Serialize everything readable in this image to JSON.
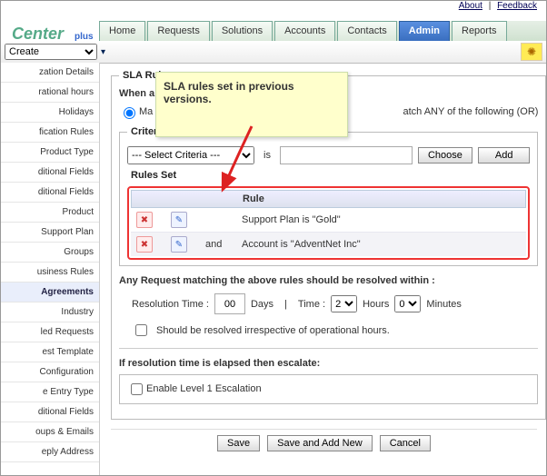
{
  "topbar": {
    "about": "About",
    "feedback": "Feedback"
  },
  "brand": {
    "main": "Center",
    "plus": "plus"
  },
  "tabs": [
    {
      "label": "Home"
    },
    {
      "label": "Requests"
    },
    {
      "label": "Solutions"
    },
    {
      "label": "Accounts"
    },
    {
      "label": "Contacts"
    },
    {
      "label": "Admin",
      "active": true
    },
    {
      "label": "Reports"
    }
  ],
  "subbar": {
    "create": "Create"
  },
  "sidebar": [
    "zation Details",
    "rational hours",
    "Holidays",
    "fication Rules",
    "Product Type",
    "ditional Fields",
    "ditional Fields",
    "Product",
    "Support Plan",
    "Groups",
    "usiness Rules",
    "Agreements",
    "Industry",
    "led Requests",
    "est Template",
    "Configuration",
    "e Entry Type",
    "ditional Fields",
    "oups & Emails",
    "eply Address"
  ],
  "sidebar_active": "Agreements",
  "callout": "SLA rules set in previous versions.",
  "sla": {
    "legend": "SLA Rul",
    "when": "When a",
    "matchAll": "Ma",
    "matchAny": "atch ANY of the following (OR)",
    "criteriaLegend": "Criteri",
    "criteriaDefault": "--- Select Criteria ---",
    "is": "is",
    "choose": "Choose",
    "add": "Add",
    "rulesSetLegend": "Rules Set",
    "ruleHead": "Rule",
    "rules": [
      {
        "and": "",
        "text": "Support Plan is \"Gold\""
      },
      {
        "and": "and",
        "text": "Account is \"AdventNet Inc\""
      }
    ],
    "resolve": {
      "line": "Any Request matching the above rules should be resolved within :",
      "resLabel": "Resolution Time :",
      "daysVal": "00",
      "days": "Days",
      "timeLabel": "Time :",
      "hoursVal": "2",
      "hours": "Hours",
      "minsVal": "0",
      "mins": "Minutes",
      "irrespective": "Should be resolved irrespective of operational hours."
    },
    "escalate": {
      "title": "If resolution time is elapsed then escalate:",
      "lvl1": "Enable Level 1 Escalation"
    }
  },
  "buttons": {
    "save": "Save",
    "saveNew": "Save and Add New",
    "cancel": "Cancel"
  }
}
